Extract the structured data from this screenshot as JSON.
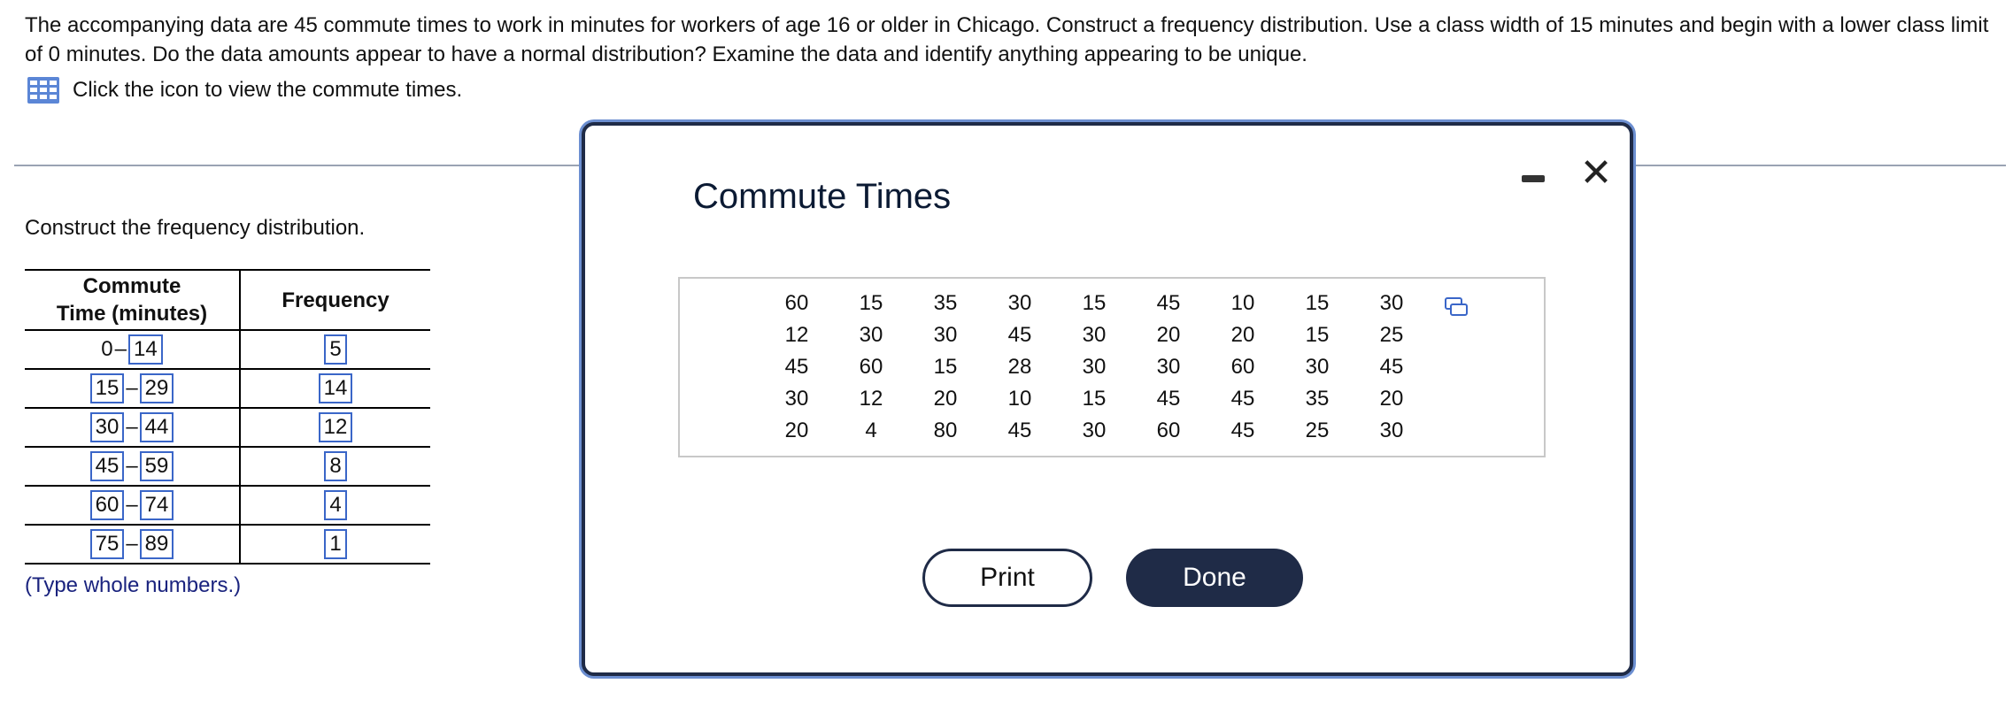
{
  "question": {
    "text": "The accompanying data are 45 commute times to work in minutes for workers of age 16 or older in Chicago. Construct a frequency distribution. Use a class width of 15 minutes and begin with a lower class limit of 0 minutes. Do the data amounts appear to have a normal distribution? Examine the data and identify anything appearing to be unique.",
    "icon_link": "Click the icon to view the commute times.",
    "icon": "table-grid-icon"
  },
  "prompt": "Construct the frequency distribution.",
  "table": {
    "header_col1_line1": "Commute",
    "header_col1_line2": "Time (minutes)",
    "header_col2": "Frequency",
    "rows": [
      {
        "lower": "0",
        "upper": "14",
        "freq": "5"
      },
      {
        "lower": "15",
        "upper": "29",
        "freq": "14"
      },
      {
        "lower": "30",
        "upper": "44",
        "freq": "12"
      },
      {
        "lower": "45",
        "upper": "59",
        "freq": "8"
      },
      {
        "lower": "60",
        "upper": "74",
        "freq": "4"
      },
      {
        "lower": "75",
        "upper": "89",
        "freq": "1"
      }
    ],
    "dash": "–"
  },
  "hint": "(Type whole numbers.)",
  "modal": {
    "title": "Commute Times",
    "minimize_icon": "minimize-icon",
    "close_icon": "close-icon",
    "close_glyph": "✕",
    "copy_icon": "copy-icon",
    "data_rows": [
      [
        "60",
        "15",
        "35",
        "30",
        "15",
        "45",
        "10",
        "15",
        "30"
      ],
      [
        "12",
        "30",
        "30",
        "45",
        "30",
        "20",
        "20",
        "15",
        "25"
      ],
      [
        "45",
        "60",
        "15",
        "28",
        "30",
        "30",
        "60",
        "30",
        "45"
      ],
      [
        "30",
        "12",
        "20",
        "10",
        "15",
        "45",
        "45",
        "35",
        "20"
      ],
      [
        "20",
        "4",
        "80",
        "45",
        "30",
        "60",
        "45",
        "25",
        "30"
      ]
    ],
    "print_label": "Print",
    "done_label": "Done"
  },
  "colors": {
    "input_border": "#3a66c8",
    "modal_dark": "#1f2b47",
    "hint_text": "#1a237e"
  }
}
